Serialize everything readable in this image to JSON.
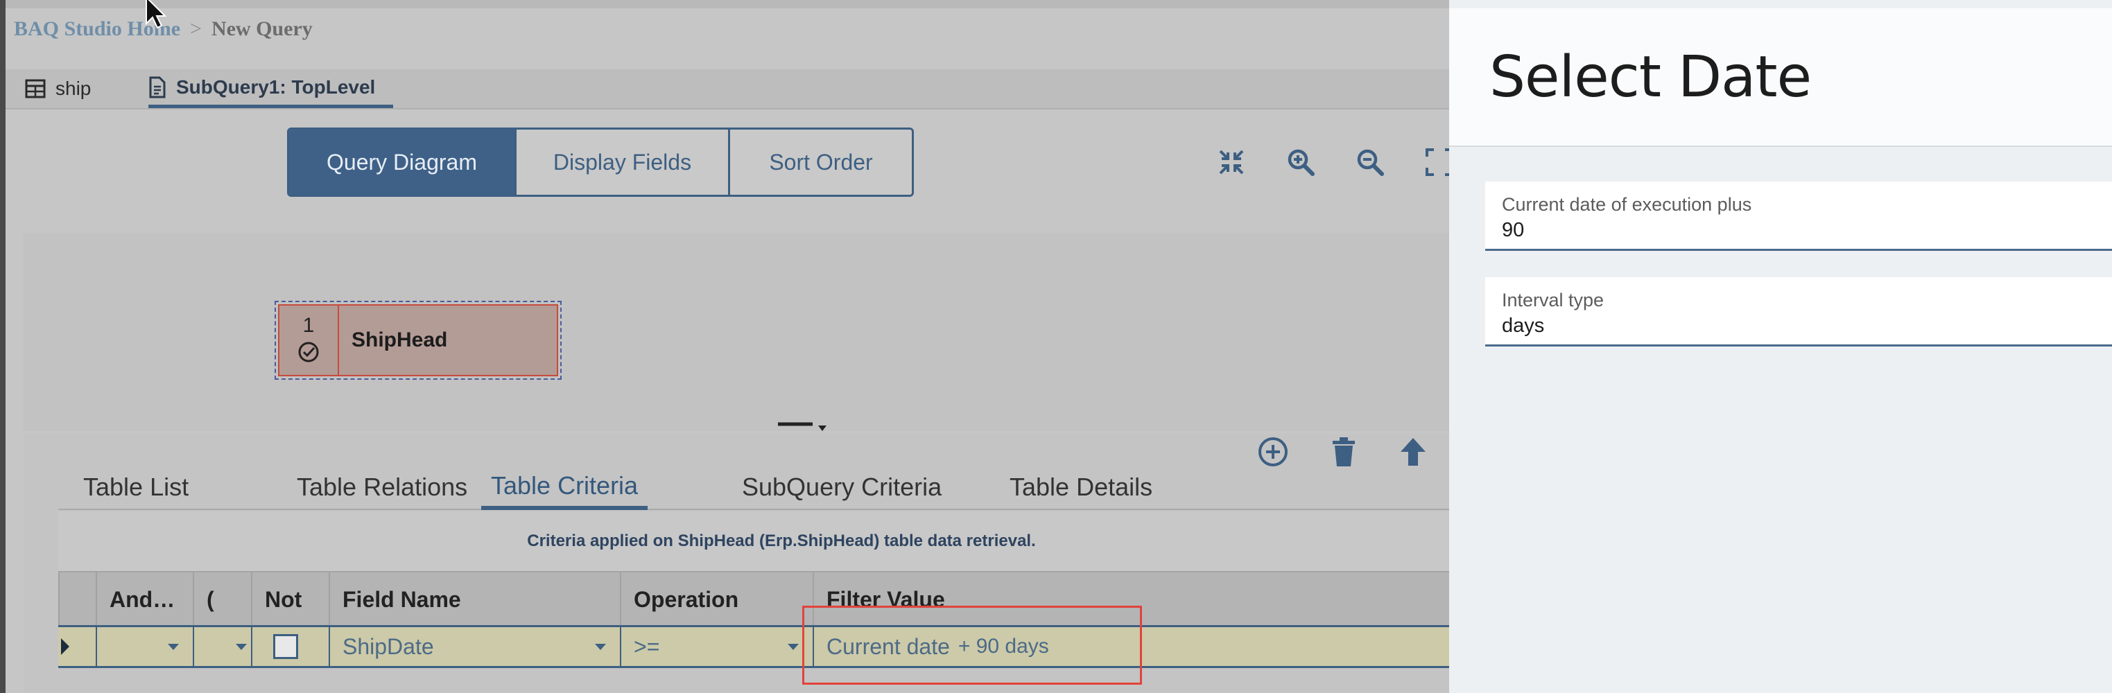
{
  "breadcrumb": {
    "home": "BAQ Studio Home",
    "separator": ">",
    "current": "New Query"
  },
  "query_tabs": [
    {
      "label": "ship",
      "icon": "table-icon"
    },
    {
      "label": "SubQuery1: TopLevel",
      "icon": "document-icon",
      "active": true
    }
  ],
  "view_switch": {
    "diagram": "Query Diagram",
    "display": "Display Fields",
    "sort": "Sort Order",
    "active": "Query Diagram"
  },
  "diagram_toolbar": [
    "collapse-icon",
    "zoom-in-icon",
    "zoom-out-icon",
    "expand-icon"
  ],
  "diagram": {
    "node_number": "1",
    "node_name": "ShipHead"
  },
  "panel_toolbar": [
    "add-icon",
    "delete-icon",
    "move-up-icon"
  ],
  "sub_tabs": {
    "list": "Table List",
    "relations": "Table Relations",
    "criteria": "Table Criteria",
    "subquery": "SubQuery Criteria",
    "details": "Table Details",
    "active": "Table Criteria"
  },
  "criteria_note": "Criteria applied on ShipHead (Erp.ShipHead) table data retrieval.",
  "grid": {
    "headers": {
      "andor": "And…",
      "paren": "(",
      "not": "Not",
      "field": "Field Name",
      "operation": "Operation",
      "filter": "Filter Value"
    },
    "row": {
      "andor": "",
      "paren": "",
      "not_checked": false,
      "field": "ShipDate",
      "operation": ">=",
      "filter_prefix": "Current date",
      "filter_suffix": "+ 90 days"
    }
  },
  "select_date": {
    "title": "Select Date",
    "plus_label": "Current date of execution plus",
    "plus_value": "90",
    "interval_label": "Interval type",
    "interval_value": "days"
  },
  "colors": {
    "accent": "#3d5f82",
    "active_segment": "#3f6188",
    "highlight": "#e2433c",
    "row_bg": "#cccaa8"
  }
}
